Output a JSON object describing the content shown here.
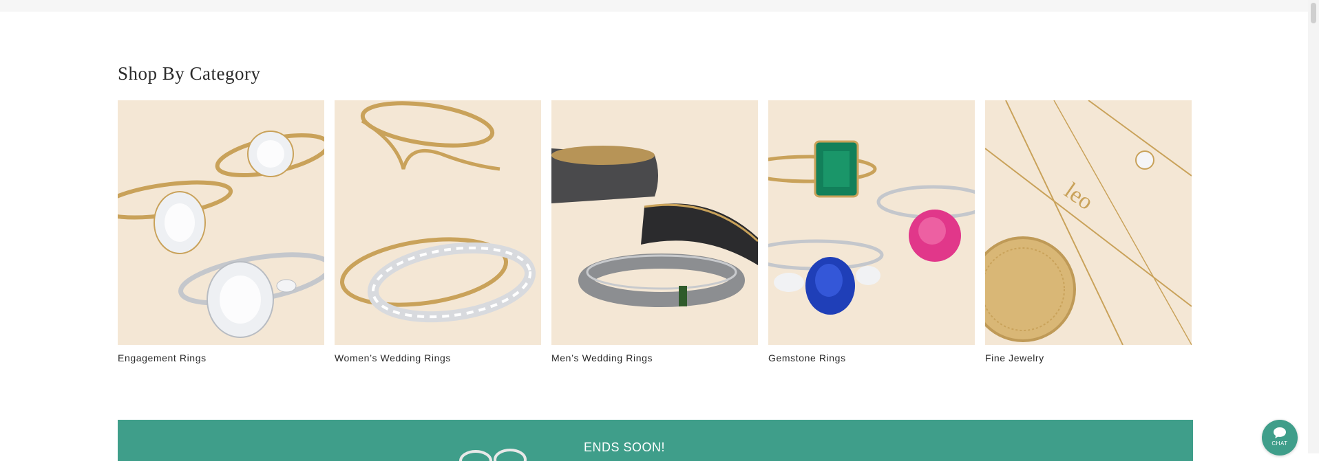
{
  "section": {
    "title": "Shop By Category"
  },
  "categories": [
    {
      "label": "Engagement Rings",
      "icon": "engagement-rings-image"
    },
    {
      "label": "Women’s Wedding Rings",
      "icon": "womens-wedding-rings-image"
    },
    {
      "label": "Men’s Wedding Rings",
      "icon": "mens-wedding-rings-image"
    },
    {
      "label": "Gemstone Rings",
      "icon": "gemstone-rings-image"
    },
    {
      "label": "Fine Jewelry",
      "icon": "fine-jewelry-image"
    }
  ],
  "promo": {
    "text": "ENDS SOON!"
  },
  "chat": {
    "label": "CHAT"
  },
  "colors": {
    "accent": "#3f9e8a",
    "card_bg": "#f4e7d5",
    "gold": "#c9a25a",
    "silver": "#c4c7cc"
  }
}
